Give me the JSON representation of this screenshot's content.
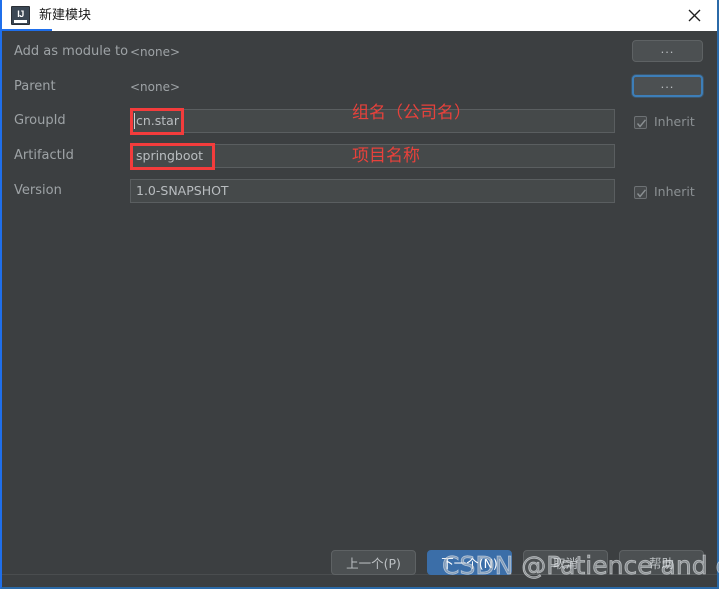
{
  "window": {
    "title": "新建模块",
    "app_icon": "intellij-idea-icon",
    "close_icon": "close-icon",
    "accent_color": "#1f6feb",
    "background_color": "#3c3f41"
  },
  "form": {
    "rows": [
      {
        "label": "Add as module to",
        "value": "<none>",
        "type": "text"
      },
      {
        "label": "Parent",
        "value": "<none>",
        "type": "text"
      },
      {
        "label": "GroupId",
        "value": "cn.star",
        "type": "input"
      },
      {
        "label": "ArtifactId",
        "value": "springboot",
        "type": "input"
      },
      {
        "label": "Version",
        "value": "1.0-SNAPSHOT",
        "type": "input"
      }
    ],
    "browse_buttons": [
      {
        "label": "...",
        "focused": false
      },
      {
        "label": "...",
        "focused": true
      }
    ],
    "inherit_checkboxes": [
      {
        "label": "Inherit",
        "checked": true
      },
      {
        "label": "Inherit",
        "checked": true
      }
    ]
  },
  "annotations": {
    "highlight_color": "#f33c3c",
    "notes": [
      {
        "text": "组名（公司名）",
        "target": "GroupId"
      },
      {
        "text": "项目名称",
        "target": "ArtifactId"
      }
    ]
  },
  "footer": {
    "buttons": [
      {
        "label": "上一个(P)",
        "primary": false
      },
      {
        "label": "下一个(N)",
        "primary": true
      },
      {
        "label": "取消",
        "primary": false
      },
      {
        "label": "帮助",
        "primary": false
      }
    ]
  },
  "watermark": {
    "text": "CSDN @Patience and effort"
  }
}
